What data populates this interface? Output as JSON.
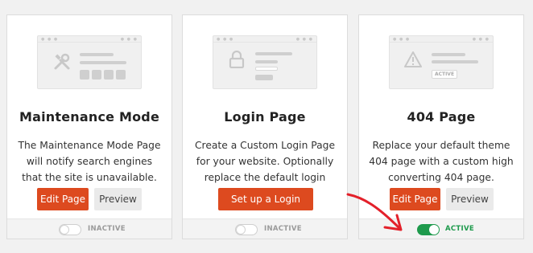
{
  "colors": {
    "primary": "#dd4a1f",
    "active": "#1e9a4c",
    "annotation_arrow": "#e3202a"
  },
  "cards": [
    {
      "illustration_icon": "tools-icon",
      "title": "Maintenance Mode",
      "description": "The Maintenance Mode Page will notify search engines that the site is unavailable.",
      "primary_label": "Edit Page",
      "secondary_label": "Preview",
      "status": "INACTIVE",
      "toggle_on": false
    },
    {
      "illustration_icon": "lock-icon",
      "title": "Login Page",
      "description": "Create a Custom Login Page for your website. Optionally replace the default login page.",
      "primary_label": "Set up a Login Page",
      "status": "INACTIVE",
      "toggle_on": false
    },
    {
      "illustration_icon": "warning-icon",
      "title": "404 Page",
      "description": "Replace your default theme 404 page with a custom high converting 404 page.",
      "primary_label": "Edit Page",
      "secondary_label": "Preview",
      "status": "ACTIVE",
      "toggle_on": true
    }
  ],
  "illustration": {
    "active_badge": "ACTIVE"
  }
}
